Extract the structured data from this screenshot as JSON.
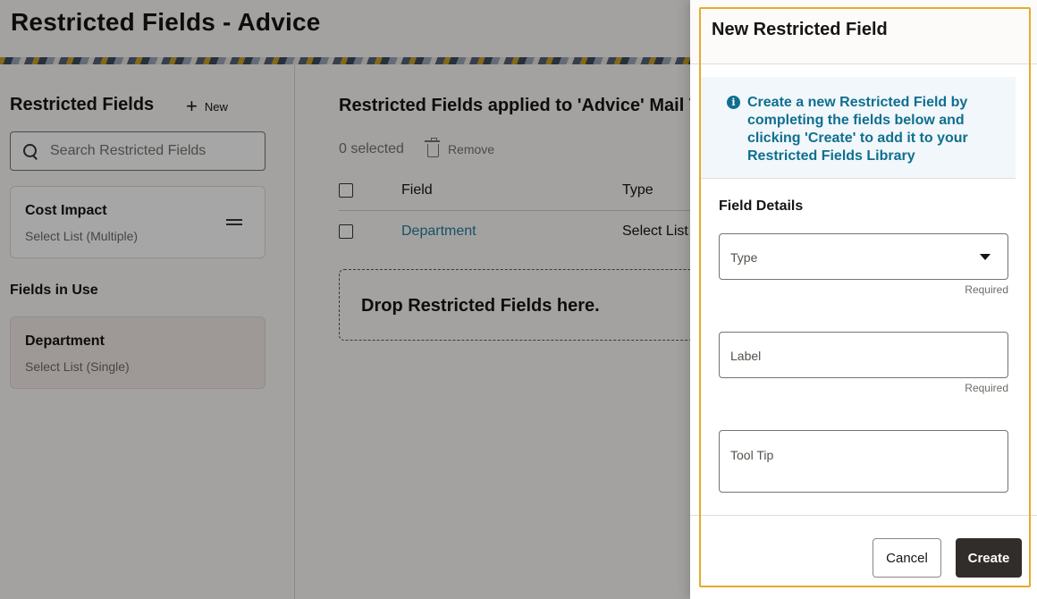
{
  "page": {
    "title": "Restricted Fields - Advice"
  },
  "left_panel": {
    "title": "Restricted Fields",
    "new_label": "New",
    "search_placeholder": "Search Restricted Fields",
    "library_items": [
      {
        "name": "Cost Impact",
        "type": "Select List (Multiple)"
      }
    ],
    "in_use_heading": "Fields in Use",
    "in_use_items": [
      {
        "name": "Department",
        "type": "Select List (Single)"
      }
    ]
  },
  "main": {
    "title": "Restricted Fields applied to 'Advice' Mail T",
    "selected_count": "0 selected",
    "remove_label": "Remove",
    "columns": {
      "field": "Field",
      "type": "Type"
    },
    "rows": [
      {
        "field": "Department",
        "type": "Select List"
      }
    ],
    "dropzone_text": "Drop Restricted Fields here."
  },
  "drawer": {
    "title": "New Restricted Field",
    "info_text": "Create a new Restricted Field by completing the fields below and clicking 'Create' to add it to your Restricted Fields Library",
    "section_title": "Field Details",
    "fields": {
      "type_placeholder": "Type",
      "label_placeholder": "Label",
      "tooltip_placeholder": "Tool Tip",
      "required_text": "Required"
    },
    "cancel_label": "Cancel",
    "create_label": "Create"
  },
  "colors": {
    "accent_link": "#227e9e",
    "info_text": "#0f6f8f",
    "highlight_border": "#e4ac2d",
    "primary_button": "#312d2a"
  }
}
